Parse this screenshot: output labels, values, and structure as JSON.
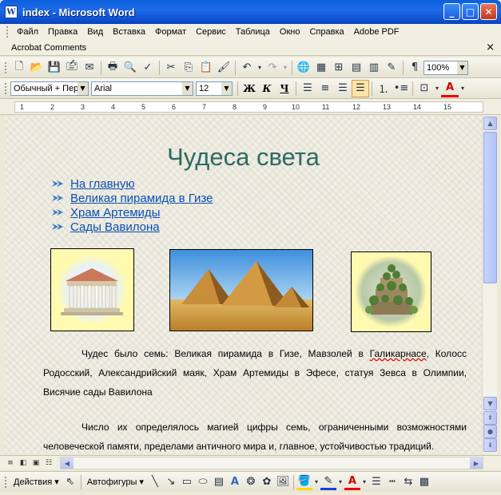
{
  "window": {
    "title": "index - Microsoft Word",
    "app_icon_letter": "W"
  },
  "menu": {
    "items": [
      "Файл",
      "Правка",
      "Вид",
      "Вставка",
      "Формат",
      "Сервис",
      "Таблица",
      "Окно",
      "Справка",
      "Adobe PDF"
    ],
    "second_row": [
      "Acrobat Comments"
    ],
    "close_glyph": "×"
  },
  "standard_toolbar": {
    "zoom": "100%"
  },
  "formatting_toolbar": {
    "style": "Обычный + Пер",
    "font": "Arial",
    "size": "12",
    "bold": "Ж",
    "italic": "К",
    "underline": "Ч"
  },
  "ruler": {
    "numbers": [
      "1",
      "2",
      "3",
      "4",
      "5",
      "6",
      "7",
      "8",
      "9",
      "10",
      "11",
      "12",
      "13",
      "14",
      "15"
    ]
  },
  "document": {
    "title": "Чудеса света",
    "links": [
      "На главную",
      "Великая пирамида в Гизе",
      "Храм Артемиды",
      "Сады Вавилона"
    ],
    "paragraph1_part1": "Чудес было семь: Великая пирамида в Гизе, Мавзолей в ",
    "paragraph1_spell": "Галикарнасе",
    "paragraph1_part2": ", Колосс Родосский, Александрийский маяк, Храм Артемиды в Эфесе, статуя Зевса в Олимпии, Висячие сады Вавилона",
    "paragraph2": "Число их определялось магией цифры семь, ограниченными возможностями человеческой памяти, пределами античного мира и, главное, устойчивостью традиций."
  },
  "drawing_toolbar": {
    "actions": "Действия",
    "autoshapes": "Автофигуры"
  },
  "colors": {
    "title_bar": "#0a5fdd",
    "doc_title": "#2d6a63",
    "link": "#0b4fb3",
    "picture_bg": "#fffab0"
  }
}
